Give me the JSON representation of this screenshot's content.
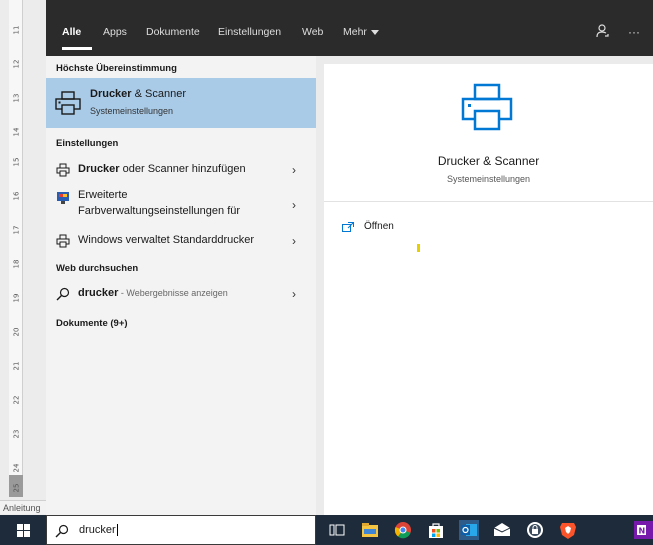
{
  "ruler": {
    "numbers": [
      "11",
      "12",
      "13",
      "14",
      "15",
      "16",
      "17",
      "18",
      "19",
      "20",
      "21",
      "22",
      "23",
      "24",
      "25"
    ],
    "status_label": "Anleitung"
  },
  "tabs": {
    "all": "Alle",
    "apps": "Apps",
    "documents": "Dokumente",
    "settings": "Einstellungen",
    "web": "Web",
    "more": "Mehr"
  },
  "results": {
    "best_match_header": "Höchste Übereinstimmung",
    "best_match": {
      "title_bold": "Drucker",
      "title_rest": " & Scanner",
      "subtitle": "Systemeinstellungen"
    },
    "settings_header": "Einstellungen",
    "settings_items": [
      {
        "bold": "Drucker",
        "rest": " oder Scanner hinzufügen"
      },
      {
        "line1": "Erweiterte",
        "line2": "Farbverwaltungseinstellungen für"
      },
      {
        "text": "Windows verwaltet Standarddrucker"
      }
    ],
    "web_header": "Web durchsuchen",
    "web_item": {
      "bold": "drucker",
      "dim": " - Webergebnisse anzeigen"
    },
    "documents_header": "Dokumente (9+)"
  },
  "detail": {
    "title": "Drucker & Scanner",
    "subtitle": "Systemeinstellungen",
    "open_action": "Öffnen"
  },
  "search": {
    "value": "drucker"
  },
  "colors": {
    "selection": "#a9cbe8",
    "accent": "#0078d4",
    "taskbar": "#1e2b3a",
    "topbar": "#2b2b2b"
  },
  "taskbar_icons": [
    "task-view-icon",
    "file-explorer-icon",
    "chrome-icon",
    "store-icon",
    "outlook-icon",
    "mail-icon",
    "keepass-icon",
    "brave-icon",
    "onenote-icon"
  ]
}
